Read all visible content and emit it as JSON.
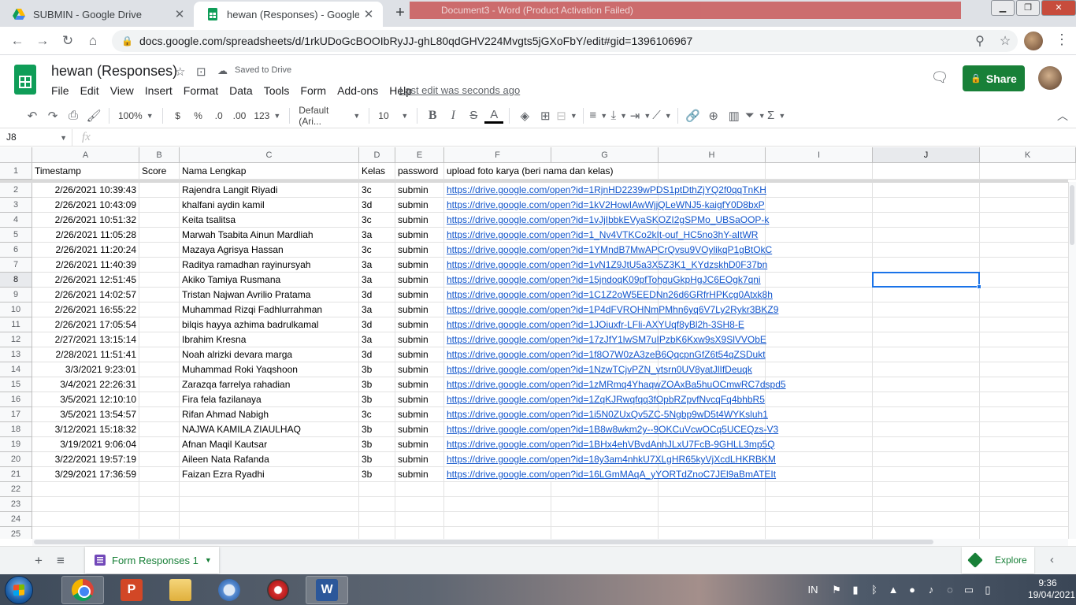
{
  "browser": {
    "tabs": [
      {
        "title": "SUBMIN - Google Drive",
        "close": "✕"
      },
      {
        "title": "hewan (Responses) - Google She",
        "close": "✕"
      }
    ],
    "new_tab": "+",
    "background_window_title": "Document3 - Word (Product Activation Failed)",
    "url": "docs.google.com/spreadsheets/d/1rkUDoGcBOOIbRyJJ-ghL80qdGHV224Mvgts5jGXoFbY/edit#gid=1396106967"
  },
  "sheet_header": {
    "title": "hewan (Responses)",
    "saved_status": "Saved to Drive",
    "menus": [
      "File",
      "Edit",
      "View",
      "Insert",
      "Format",
      "Data",
      "Tools",
      "Form",
      "Add-ons",
      "Help"
    ],
    "last_edit": "Last edit was seconds ago",
    "share_label": "Share"
  },
  "toolbar": {
    "zoom": "100%",
    "currency": "$",
    "percent": "%",
    "dec_decrease": ".0",
    "dec_increase": ".00",
    "more_formats": "123",
    "font": "Default (Ari...",
    "font_size": "10",
    "bold": "B",
    "italic": "I",
    "strike": "S",
    "text_color": "A",
    "sum": "Σ"
  },
  "formula_bar": {
    "cell_ref": "J8",
    "fx": "fx",
    "value": ""
  },
  "grid": {
    "columns": [
      "A",
      "B",
      "C",
      "D",
      "E",
      "F",
      "G",
      "H",
      "I",
      "J",
      "K"
    ],
    "selected_column": "J",
    "selected_row": "8",
    "header_row": {
      "num": "1",
      "A": "Timestamp",
      "B": "Score",
      "C": "Nama  Lengkap",
      "D": "Kelas",
      "E": "password",
      "F": "upload  foto karya (beri nama dan kelas)"
    },
    "rows": [
      {
        "num": "2",
        "timestamp": "2/26/2021 10:39:43",
        "name": "Rajendra Langit Riyadi",
        "kelas": "3c",
        "password": "submin",
        "link": "https://drive.google.com/open?id=1RjnHD2239wPDS1ptDthZjYQ2f0qqTnKH"
      },
      {
        "num": "3",
        "timestamp": "2/26/2021 10:43:09",
        "name": "khalfani aydin kamil",
        "kelas": "3d",
        "password": "submin",
        "link": "https://drive.google.com/open?id=1kV2HowIAwWjjQLeWNJ5-kaigfY0D8bxP"
      },
      {
        "num": "4",
        "timestamp": "2/26/2021 10:51:32",
        "name": "Keita tsalitsa",
        "kelas": "3c",
        "password": "submin",
        "link": "https://drive.google.com/open?id=1vJjIbbkEVyaSKOZI2gSPMo_UBSaOOP-k"
      },
      {
        "num": "5",
        "timestamp": "2/26/2021 11:05:28",
        "name": "Marwah Tsabita Ainun Mardliah",
        "kelas": "3a",
        "password": "submin",
        "link": "https://drive.google.com/open?id=1_Nv4VTKCo2kIt-ouf_HC5no3hY-aItWR"
      },
      {
        "num": "6",
        "timestamp": "2/26/2021 11:20:24",
        "name": "Mazaya Agrisya Hassan",
        "kelas": "3c",
        "password": "submin",
        "link": "https://drive.google.com/open?id=1YMndB7MwAPCrQvsu9VOylikqP1gBtOkC"
      },
      {
        "num": "7",
        "timestamp": "2/26/2021 11:40:39",
        "name": "Raditya ramadhan rayinursyah",
        "kelas": "3a",
        "password": "submin",
        "link": "https://drive.google.com/open?id=1vN1Z9JtU5a3X5Z3K1_KYdzskhD0F37bn"
      },
      {
        "num": "8",
        "timestamp": "2/26/2021 12:51:45",
        "name": "Akiko Tamiya Rusmana",
        "kelas": "3a",
        "password": "submin",
        "link": "https://drive.google.com/open?id=15jndoqK09pfTohguGkpHgJC6EOgk7qni"
      },
      {
        "num": "9",
        "timestamp": "2/26/2021 14:02:57",
        "name": "Tristan Najwan Avrilio Pratama",
        "kelas": "3d",
        "password": "submin",
        "link": "https://drive.google.com/open?id=1C1Z2oW5EEDNn26d6GRfrHPKcg0Atxk8h"
      },
      {
        "num": "10",
        "timestamp": "2/26/2021 16:55:22",
        "name": "Muhammad Rizqi Fadhlurrahman",
        "kelas": "3a",
        "password": "submin",
        "link": "https://drive.google.com/open?id=1P4dFVROHNmPMhn6yq6V7Ly2Rykr3BKZ9"
      },
      {
        "num": "11",
        "timestamp": "2/26/2021 17:05:54",
        "name": "bilqis hayya azhima badrulkamal",
        "kelas": "3d",
        "password": "submin",
        "link": "https://drive.google.com/open?id=1JOiuxfr-LFli-AXYUqf8yBl2h-3SH8-E"
      },
      {
        "num": "12",
        "timestamp": "2/27/2021 13:15:14",
        "name": "Ibrahim Kresna",
        "kelas": "3a",
        "password": "submin",
        "link": "https://drive.google.com/open?id=17zJfY1lwSM7uIPzbK6Kxw9sX9SlVVObE"
      },
      {
        "num": "13",
        "timestamp": "2/28/2021 11:51:41",
        "name": "Noah alrizki devara marga",
        "kelas": "3d",
        "password": "submin",
        "link": "https://drive.google.com/open?id=1f8O7W0zA3zeB6QqcpnGfZ6t54qZSDukt"
      },
      {
        "num": "14",
        "timestamp": "3/3/2021 9:23:01",
        "name": "Muhammad Roki Yaqshoon",
        "kelas": "3b",
        "password": "submin",
        "link": "https://drive.google.com/open?id=1NzwTCjvPZN_vtsrn0UV8yatJlIfDeuqk"
      },
      {
        "num": "15",
        "timestamp": "3/4/2021 22:26:31",
        "name": "Zarazqa farrelya rahadian",
        "kelas": "3b",
        "password": "submin",
        "link": "https://drive.google.com/open?id=1zMRmq4YhaqwZOAxBa5huOCmwRC7dspd5"
      },
      {
        "num": "16",
        "timestamp": "3/5/2021 12:10:10",
        "name": "Fira fela fazilanaya",
        "kelas": "3b",
        "password": "submin",
        "link": "https://drive.google.com/open?id=1ZqKJRwqfqq3fOpbRZpvfNvcqFq4bhbR5"
      },
      {
        "num": "17",
        "timestamp": "3/5/2021 13:54:57",
        "name": "Rifan Ahmad Nabigh",
        "kelas": "3c",
        "password": "submin",
        "link": "https://drive.google.com/open?id=1i5N0ZUxQv5ZC-5Ngbp9wD5t4WYKsluh1"
      },
      {
        "num": "18",
        "timestamp": "3/12/2021 15:18:32",
        "name": "NAJWA KAMILA ZIAULHAQ",
        "kelas": "3b",
        "password": "submin",
        "link": "https://drive.google.com/open?id=1B8w8wkm2y--9OKCuVcwOCq5UCEQzs-V3"
      },
      {
        "num": "19",
        "timestamp": "3/19/2021 9:06:04",
        "name": "Afnan Maqil Kautsar",
        "kelas": "3b",
        "password": "submin",
        "link": "https://drive.google.com/open?id=1BHx4ehVBvdAnhJLxU7FcB-9GHLL3mp5Q"
      },
      {
        "num": "20",
        "timestamp": "3/22/2021 19:57:19",
        "name": "Aileen Nata Rafanda",
        "kelas": "3b",
        "password": "submin",
        "link": "https://drive.google.com/open?id=18y3am4nhkU7XLgHR65kyVjXcdLHKRBKM"
      },
      {
        "num": "21",
        "timestamp": "3/29/2021 17:36:59",
        "name": "Faizan Ezra Ryadhi",
        "kelas": "3b",
        "password": "submin",
        "link": "https://drive.google.com/open?id=16LGmMAqA_yYORTdZnoC7JEl9aBmATEIt"
      }
    ],
    "empty_rows": [
      "22",
      "23",
      "24",
      "25"
    ]
  },
  "sheet_tabs": {
    "add": "+",
    "list": "≡",
    "active": "Form Responses 1",
    "explore": "Explore"
  },
  "taskbar": {
    "lang": "IN",
    "time": "9:36",
    "date": "19/04/2021"
  },
  "colors": {
    "sheets_green": "#0f9d58",
    "share_green": "#188038",
    "link_blue": "#1155cc",
    "selection_blue": "#1a73e8",
    "forms_purple": "#7248b9"
  }
}
